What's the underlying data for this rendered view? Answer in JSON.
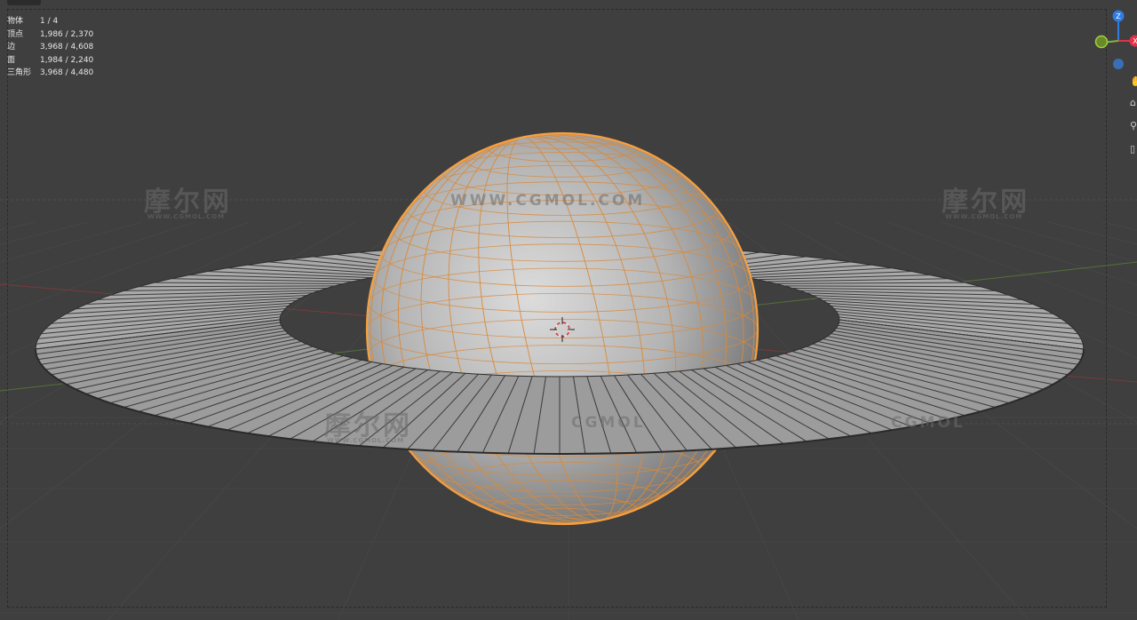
{
  "stats": {
    "rows": [
      {
        "label": "物体",
        "value": "1 / 4"
      },
      {
        "label": "顶点",
        "value": "1,986 / 2,370"
      },
      {
        "label": "边",
        "value": "3,968 / 4,608"
      },
      {
        "label": "面",
        "value": "1,984 / 2,240"
      },
      {
        "label": "三角形",
        "value": "3,968 / 4,480"
      }
    ]
  },
  "watermarks": {
    "cn": "摩尔网",
    "sub": "WWW.CGMOL.COM",
    "url": "WWW.CGMOL.COM",
    "brand": "CGMOL"
  },
  "gizmo": {
    "z_label": "Z",
    "x_label": "X",
    "colors": {
      "z": "#2f7de0",
      "x": "#e0334a",
      "y": "#7fb830",
      "neg": "#3a6fb5"
    }
  },
  "colors": {
    "background": "#3f3f3f",
    "selection": "#f5a040",
    "mesh_fill": "#9a9a9a",
    "grid_line": "#474747",
    "x_axis": "#8a3a3a",
    "y_axis": "#5a7a3a"
  },
  "icons": [
    "hand-icon",
    "camera-icon",
    "zoom-icon",
    "lock-icon"
  ]
}
